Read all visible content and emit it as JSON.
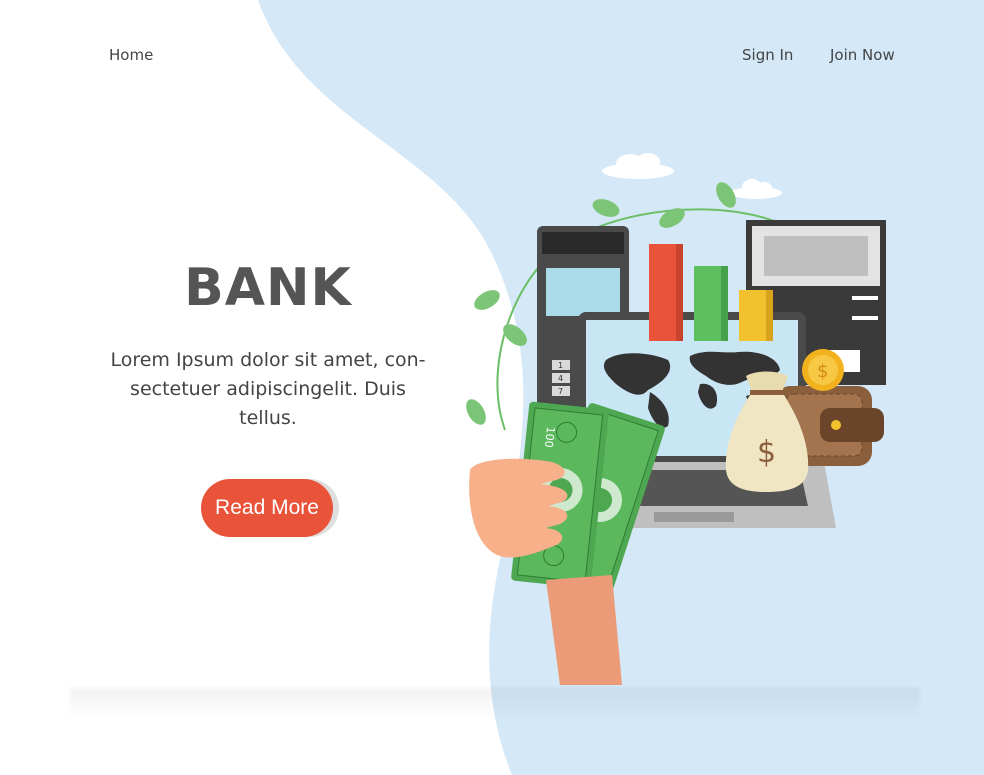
{
  "nav": {
    "home": "Home",
    "sign_in": "Sign In",
    "join_now": "Join Now"
  },
  "hero": {
    "title": "BANK",
    "description": "Lorem Ipsum dolor sit amet, con-sectetuer adipiscingelit. Duis tellus.",
    "cta": "Read More"
  },
  "illustration": {
    "bill_denomination": "100",
    "currency_symbol": "$",
    "terminal_keys": [
      "1",
      "4",
      "7"
    ]
  },
  "colors": {
    "accent": "#e8533a",
    "background_blob": "#d4e8f7",
    "money_green": "#5bb85d",
    "leaf_green": "#7cc576",
    "bar_red": "#e8533a",
    "bar_green": "#5bc05d",
    "bar_yellow": "#f2c12e"
  },
  "icons": [
    "payment-terminal-icon",
    "bar-chart-icon",
    "atm-icon",
    "laptop-icon",
    "world-map-icon",
    "money-bag-icon",
    "wallet-icon",
    "coin-icon",
    "banknotes-icon",
    "hand-icon",
    "cloud-icon",
    "leaf-icon"
  ]
}
